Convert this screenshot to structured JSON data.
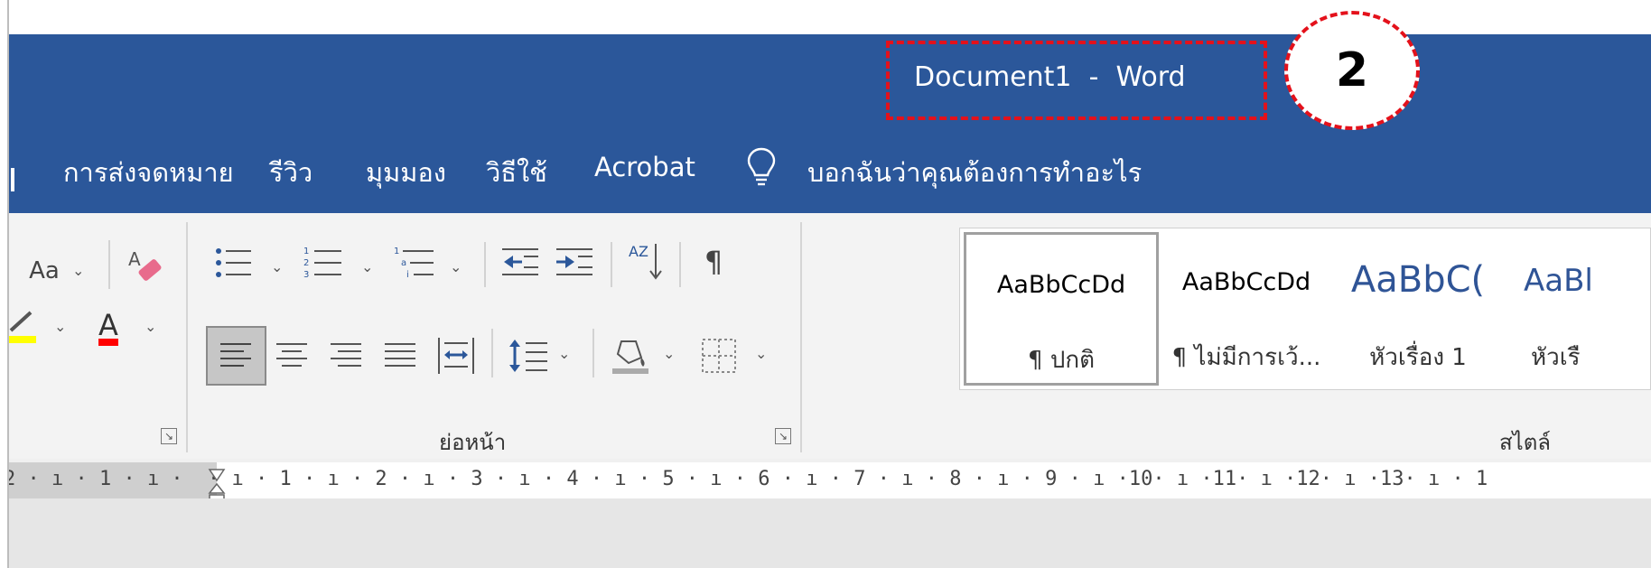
{
  "window": {
    "title": "Document1  -  Word",
    "callout_number": "2"
  },
  "colors": {
    "titlebar": "#2b579a",
    "annotation": "#e4111b",
    "ribbon": "#f3f3f3"
  },
  "tabs": [
    {
      "label": "การส่งจดหมาย"
    },
    {
      "label": "รีวิว"
    },
    {
      "label": "มุมมอง"
    },
    {
      "label": "วิธีใช้"
    },
    {
      "label": "Acrobat"
    },
    {
      "label": "บอกฉันว่าคุณต้องการทำอะไร",
      "icon": "lightbulb-icon"
    }
  ],
  "font_group": {
    "change_case_label": "Aa",
    "font_color_label": "A",
    "highlight_color": "#ffff00",
    "font_color": "#ff0000",
    "icons": [
      "change-case-icon",
      "clear-formatting-icon",
      "highlight-icon",
      "font-color-icon"
    ]
  },
  "paragraph_group": {
    "label": "ย่อหน้า",
    "icons": [
      "bullets-icon",
      "numbering-icon",
      "multilevel-list-icon",
      "decrease-indent-icon",
      "increase-indent-icon",
      "sort-icon",
      "show-marks-icon",
      "align-left-icon",
      "align-center-icon",
      "align-right-icon",
      "justify-icon",
      "distributed-icon",
      "line-spacing-icon",
      "shading-icon",
      "borders-icon"
    ],
    "sort_letters": "AZ",
    "show_marks_glyph": "¶"
  },
  "styles_group": {
    "label": "สไตล์",
    "styles": [
      {
        "sample": "AaBbCcDd",
        "name": "¶ ปกติ",
        "selected": true
      },
      {
        "sample": "AaBbCcDd",
        "name": "¶ ไม่มีการเว้...",
        "selected": false
      },
      {
        "sample": "AaBbC(",
        "name": "หัวเรื่อง 1",
        "selected": false
      },
      {
        "sample": "AaBl",
        "name": "หัวเรื",
        "selected": false
      }
    ]
  },
  "ruler": {
    "left_text": "2 · ı · 1 · ı ·",
    "main_text": "· ı · 1 · ı · 2 · ı · 3 · ı · 4 · ı · 5 · ı · 6 · ı · 7 · ı · 8 · ı · 9 · ı ·10· ı ·11· ı ·12· ı ·13· ı · 1"
  }
}
